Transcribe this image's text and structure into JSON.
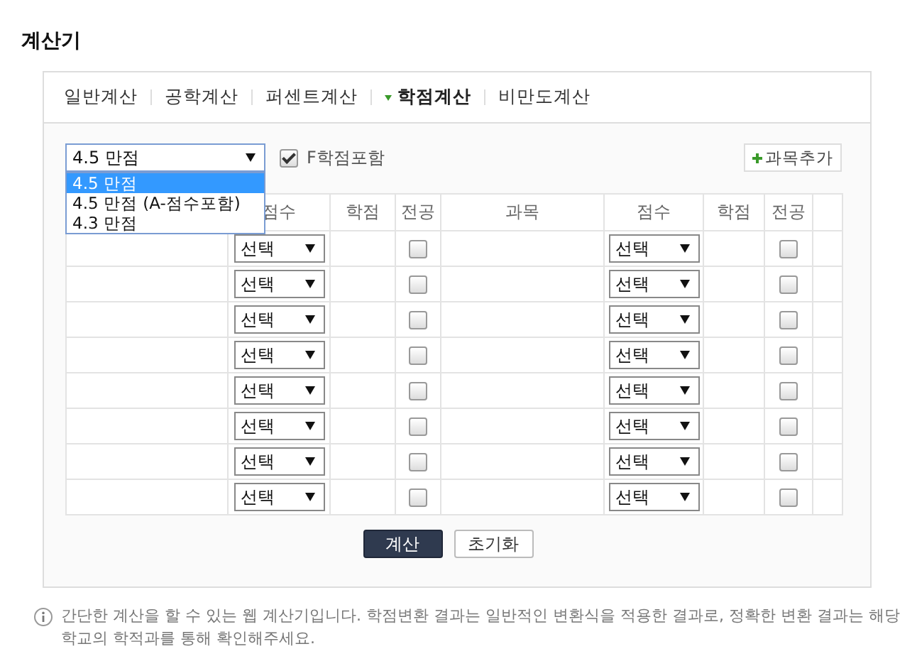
{
  "title": "계산기",
  "tabs": [
    {
      "label": "일반계산",
      "selected": false
    },
    {
      "label": "공학계산",
      "selected": false
    },
    {
      "label": "퍼센트계산",
      "selected": false
    },
    {
      "label": "학점계산",
      "selected": true
    },
    {
      "label": "비만도계산",
      "selected": false
    }
  ],
  "scale_select": {
    "value": "4.5 만점",
    "expanded": true,
    "options": [
      {
        "label": "4.5 만점",
        "selected": true
      },
      {
        "label": "4.5 만점 (A-점수포함)",
        "selected": false
      },
      {
        "label": "4.3 만점",
        "selected": false
      }
    ]
  },
  "include_f": {
    "label": "F학점포함",
    "checked": true
  },
  "add_subject_button": "과목추가",
  "table": {
    "columns": [
      "점수",
      "학점",
      "전공",
      "과목",
      "점수",
      "학점",
      "전공"
    ],
    "rows": [
      {
        "left": {
          "grade": "선택",
          "major": false
        },
        "right": {
          "grade": "선택",
          "major": false
        }
      },
      {
        "left": {
          "grade": "선택",
          "major": false
        },
        "right": {
          "grade": "선택",
          "major": false
        }
      },
      {
        "left": {
          "grade": "선택",
          "major": false
        },
        "right": {
          "grade": "선택",
          "major": false
        }
      },
      {
        "left": {
          "grade": "선택",
          "major": false
        },
        "right": {
          "grade": "선택",
          "major": false
        }
      },
      {
        "left": {
          "grade": "선택",
          "major": false
        },
        "right": {
          "grade": "선택",
          "major": false
        }
      },
      {
        "left": {
          "grade": "선택",
          "major": false
        },
        "right": {
          "grade": "선택",
          "major": false
        }
      },
      {
        "left": {
          "grade": "선택",
          "major": false
        },
        "right": {
          "grade": "선택",
          "major": false
        }
      },
      {
        "left": {
          "grade": "선택",
          "major": false
        },
        "right": {
          "grade": "선택",
          "major": false
        }
      }
    ]
  },
  "buttons": [
    {
      "label": "계산",
      "kind": "primary"
    },
    {
      "label": "초기화",
      "kind": "secondary"
    }
  ],
  "note": [
    "간단한 계산을 할 수 있는 웹 계산기입니다. 학점변환 결과는 일반적인 변환식을 적용한 결과로, 정확한 변환 결과는 해당",
    "학교의 학적과를 통해 확인해주세요."
  ]
}
